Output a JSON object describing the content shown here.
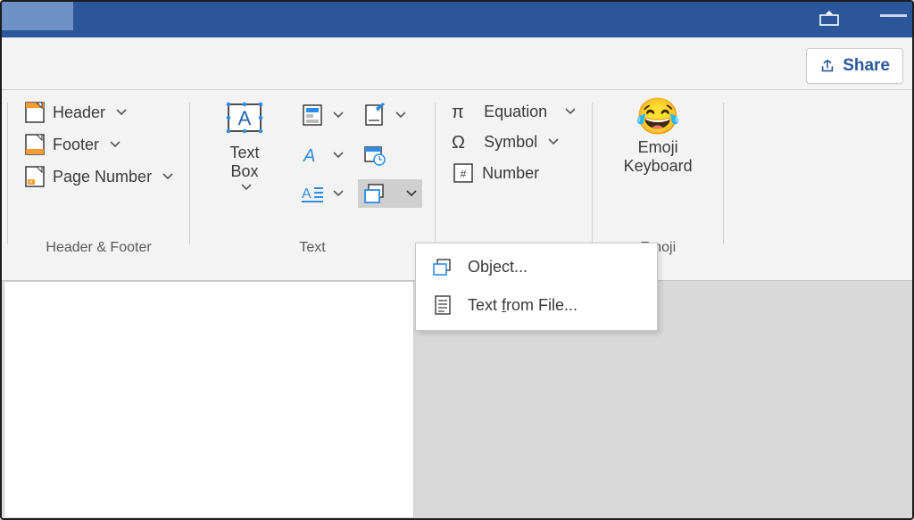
{
  "titlebar": {
    "ribbon_toggle_tooltip": "Ribbon Display Options",
    "minimize_tooltip": "Minimize"
  },
  "share": {
    "label": "Share"
  },
  "ribbon": {
    "groups": {
      "header_footer": {
        "label": "Header & Footer",
        "items": {
          "header": "Header",
          "footer": "Footer",
          "page_number": "Page Number"
        }
      },
      "text": {
        "label": "Text",
        "text_box": "Text\nBox"
      },
      "symbols": {
        "equation": "Equation",
        "symbol": "Symbol",
        "number": "Number"
      },
      "emoji": {
        "label": "Emoji",
        "button": "Emoji\nKeyboard"
      }
    }
  },
  "menu": {
    "object": "Object...",
    "text_from_file": "Text from File..."
  }
}
